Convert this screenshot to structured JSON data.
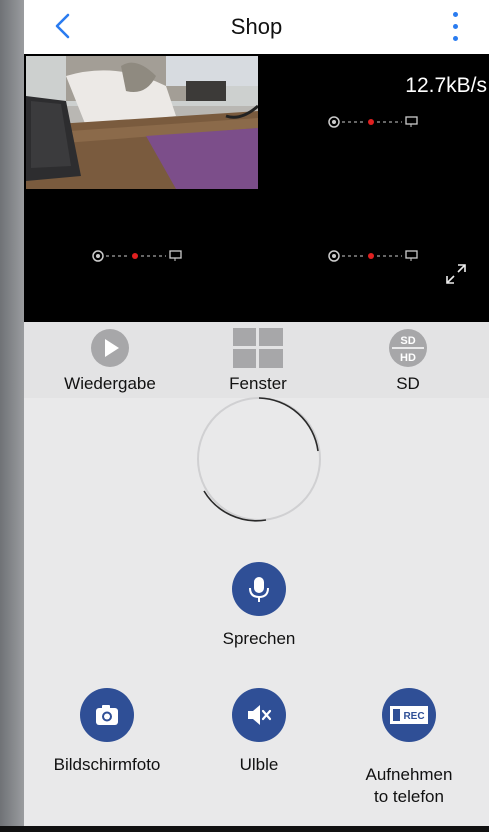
{
  "nav": {
    "title": "Shop",
    "back_icon": "chevron-left-icon",
    "menu_icon": "more-vertical-icon",
    "accent": "#2a7cf0"
  },
  "video": {
    "speed": "12.7kB/s"
  },
  "controls": [
    {
      "label": "Wiedergabe",
      "icon": "play-icon"
    },
    {
      "label": "Fenster",
      "icon": "grid-icon"
    },
    {
      "label": "SD",
      "icon": "sd-hd-icon"
    }
  ],
  "actions": {
    "talk": {
      "label": "Sprechen",
      "icon": "microphone-icon"
    },
    "snapshot": {
      "label": "Bildschirmfoto",
      "icon": "camera-icon"
    },
    "mute": {
      "label": "Ulble",
      "icon": "speaker-mute-icon"
    },
    "record": {
      "label_line1": "Aufnehmen",
      "label_line2": "to telefon",
      "icon_text": "REC",
      "icon": "record-icon"
    }
  },
  "colors": {
    "action_blue": "#2f4f96",
    "link_red": "#e02020"
  }
}
